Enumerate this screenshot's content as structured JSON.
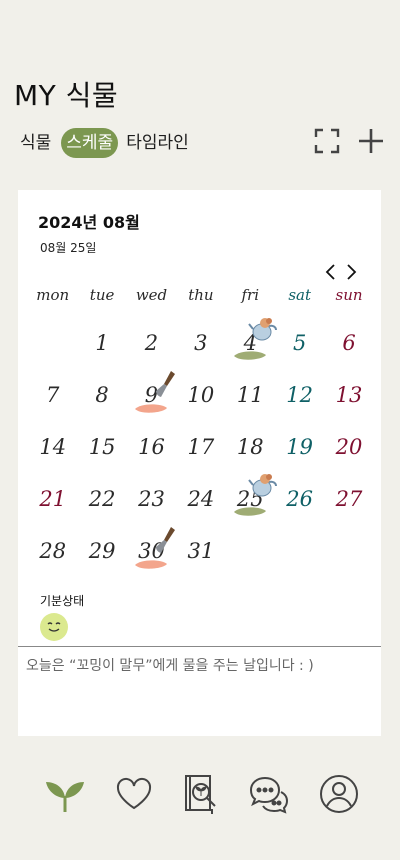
{
  "header": {
    "title": "MY 식물",
    "tabs": [
      {
        "label": "식물",
        "active": false
      },
      {
        "label": "스케줄",
        "active": true
      },
      {
        "label": "타임라인",
        "active": false
      }
    ],
    "icons": [
      "fullscreen-icon",
      "plus-icon"
    ]
  },
  "calendar": {
    "month_label": "2024년 08월",
    "selected_date": "08월 25일",
    "weekdays": [
      "mon",
      "tue",
      "wed",
      "thu",
      "fri",
      "sat",
      "sun"
    ],
    "weeks": [
      [
        "",
        "1",
        "2",
        "3",
        "4",
        "5",
        "6"
      ],
      [
        "7",
        "8",
        "9",
        "10",
        "11",
        "12",
        "13"
      ],
      [
        "14",
        "15",
        "16",
        "17",
        "18",
        "19",
        "20"
      ],
      [
        "21",
        "22",
        "23",
        "24",
        "25",
        "26",
        "27"
      ],
      [
        "28",
        "29",
        "30",
        "31",
        "",
        "",
        ""
      ]
    ],
    "holiday": "21",
    "watering_days": [
      "4",
      "25"
    ],
    "repotting_days": [
      "9",
      "30"
    ]
  },
  "mood": {
    "label": "기분상태",
    "icon": "smiley-face-icon"
  },
  "note": "오늘은 “꼬밍이 말무”에게 물을 주는 날입니다 : )",
  "bottom_nav": [
    "plant-icon",
    "heart-icon",
    "plant-book-icon",
    "chat-icon",
    "profile-icon"
  ],
  "colors": {
    "background": "#f1f0ea",
    "accent": "#7c9750",
    "saturday": "#0f6066",
    "sunday": "#7e1030",
    "watering_mark": "#8e9e5c",
    "repotting_mark": "#f29b7f"
  }
}
